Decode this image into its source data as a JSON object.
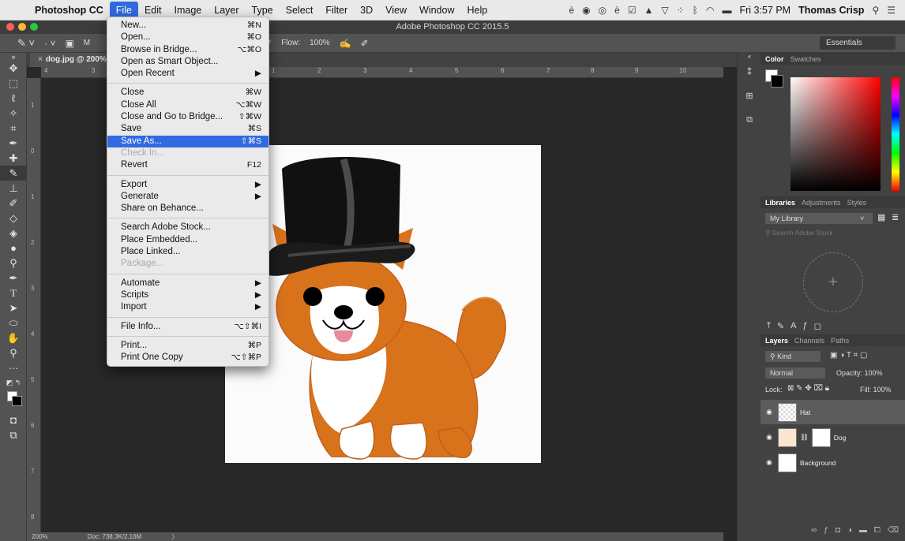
{
  "menubar": {
    "app": "Photoshop CC",
    "items": [
      "File",
      "Edit",
      "Image",
      "Layer",
      "Type",
      "Select",
      "Filter",
      "3D",
      "View",
      "Window",
      "Help"
    ],
    "clock": "Fri 3:57 PM",
    "user": "Thomas Crisp"
  },
  "window": {
    "title": "Adobe Photoshop CC 2015.5"
  },
  "options": {
    "flow_label": "Flow:",
    "flow_value": "100%",
    "workspace": "Essentials",
    "mode_initial": "M"
  },
  "document": {
    "tab": "dog.jpg @ 200% (",
    "zoom": "200%",
    "doc_size": "Doc: 738.3K/2.16M"
  },
  "rulers": {
    "h": [
      "4",
      "3",
      "1",
      "2",
      "3",
      "4",
      "5",
      "6",
      "7",
      "8",
      "9",
      "10"
    ],
    "v": [
      "1",
      "0",
      "1",
      "2",
      "3",
      "4",
      "5",
      "6",
      "7",
      "8"
    ]
  },
  "file_menu": [
    {
      "label": "New...",
      "shortcut": "⌘N"
    },
    {
      "label": "Open...",
      "shortcut": "⌘O"
    },
    {
      "label": "Browse in Bridge...",
      "shortcut": "⌥⌘O"
    },
    {
      "label": "Open as Smart Object...",
      "shortcut": ""
    },
    {
      "label": "Open Recent",
      "shortcut": "▶"
    },
    {
      "sep": true
    },
    {
      "label": "Close",
      "shortcut": "⌘W"
    },
    {
      "label": "Close All",
      "shortcut": "⌥⌘W"
    },
    {
      "label": "Close and Go to Bridge...",
      "shortcut": "⇧⌘W"
    },
    {
      "label": "Save",
      "shortcut": "⌘S"
    },
    {
      "label": "Save As...",
      "shortcut": "⇧⌘S",
      "highlight": true
    },
    {
      "label": "Check In...",
      "shortcut": "",
      "disabled": true
    },
    {
      "label": "Revert",
      "shortcut": "F12"
    },
    {
      "sep": true
    },
    {
      "label": "Export",
      "shortcut": "▶"
    },
    {
      "label": "Generate",
      "shortcut": "▶"
    },
    {
      "label": "Share on Behance...",
      "shortcut": ""
    },
    {
      "sep": true
    },
    {
      "label": "Search Adobe Stock...",
      "shortcut": ""
    },
    {
      "label": "Place Embedded...",
      "shortcut": ""
    },
    {
      "label": "Place Linked...",
      "shortcut": ""
    },
    {
      "label": "Package...",
      "shortcut": "",
      "disabled": true
    },
    {
      "sep": true
    },
    {
      "label": "Automate",
      "shortcut": "▶"
    },
    {
      "label": "Scripts",
      "shortcut": "▶"
    },
    {
      "label": "Import",
      "shortcut": "▶"
    },
    {
      "sep": true
    },
    {
      "label": "File Info...",
      "shortcut": "⌥⇧⌘I"
    },
    {
      "sep": true
    },
    {
      "label": "Print...",
      "shortcut": "⌘P"
    },
    {
      "label": "Print One Copy",
      "shortcut": "⌥⇧⌘P"
    }
  ],
  "panels": {
    "color_tabs": [
      "Color",
      "Swatches"
    ],
    "lib_tabs": [
      "Libraries",
      "Adjustments",
      "Styles"
    ],
    "library_name": "My Library",
    "stock_placeholder": "Search Adobe Stock",
    "layers_tabs": [
      "Layers",
      "Channels",
      "Paths"
    ],
    "filter_kind": "Kind",
    "blend_mode": "Normal",
    "opacity_label": "Opacity:",
    "opacity_value": "100%",
    "lock_label": "Lock:",
    "fill_label": "Fill:",
    "fill_value": "100%",
    "layers": [
      "Hat",
      "Dog",
      "Background"
    ]
  },
  "colors": {
    "accent": "#2f6ae0",
    "panel": "#424242",
    "dog_orange": "#d8731c"
  }
}
